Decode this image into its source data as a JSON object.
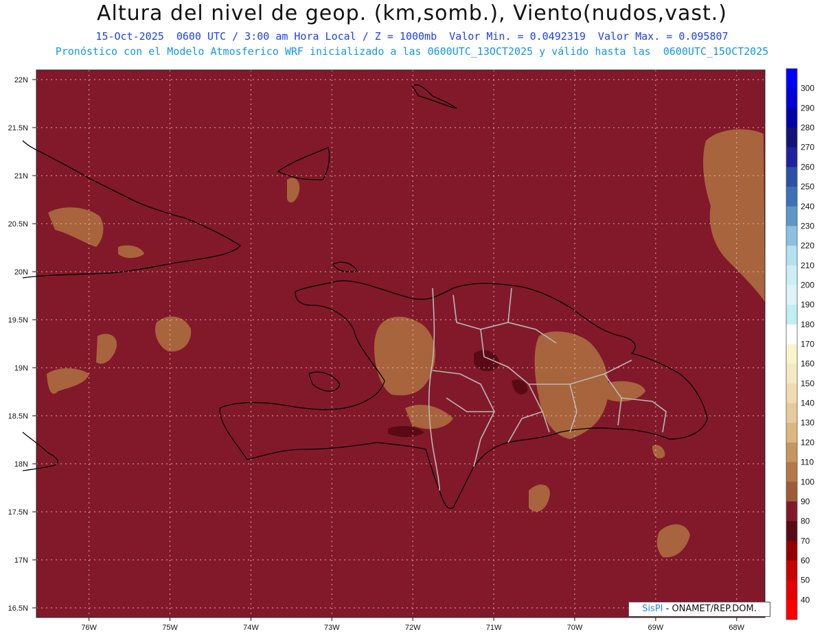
{
  "header": {
    "title": "Altura del nivel de geop. (km,somb.), Viento(nudos,vast.)",
    "subtitle": "15-Oct-2025  0600 UTC / 3:00 am Hora Local / Z = 1000mb  Valor Min. = 0.0492319  Valor Max. = 0.095807",
    "subtitle2": "Pronóstico con el Modelo Atmosferico WRF inicializado a las 0600UTC_13OCT2025 y válido hasta las  0600UTC_15OCT2025"
  },
  "credit": {
    "brand": "SisPI",
    "rest": " - ONAMET/REP.DOM."
  },
  "map_data": {
    "lat_ticks": [
      "22N",
      "21.5N",
      "21N",
      "20.5N",
      "20N",
      "19.5N",
      "19N",
      "18.5N",
      "18N",
      "17.5N",
      "17N",
      "16.5N"
    ],
    "lon_ticks": [
      "76W",
      "75W",
      "74W",
      "73W",
      "72W",
      "71W",
      "70W",
      "69W",
      "68W"
    ],
    "lat_range": [
      16.4,
      22.1
    ],
    "lon_range": [
      -76.65,
      -67.65
    ],
    "background_color": "#82192a",
    "shade_color": "#a8643c",
    "dark_color": "#5a0a14",
    "colorbar": [
      {
        "label": "300",
        "color": "#0000ff"
      },
      {
        "label": "290",
        "color": "#0000d8"
      },
      {
        "label": "280",
        "color": "#0000a8"
      },
      {
        "label": "270",
        "color": "#12127a"
      },
      {
        "label": "260",
        "color": "#2020a0"
      },
      {
        "label": "250",
        "color": "#2d4fa8"
      },
      {
        "label": "240",
        "color": "#3d70b4"
      },
      {
        "label": "230",
        "color": "#5e96c8"
      },
      {
        "label": "220",
        "color": "#8cc0e0"
      },
      {
        "label": "210",
        "color": "#b4e0f0"
      },
      {
        "label": "200",
        "color": "#cceef6"
      },
      {
        "label": "190",
        "color": "#ddf3f8"
      },
      {
        "label": "180",
        "color": "#bfeef5"
      },
      {
        "label": "170",
        "color": "#ffffff"
      },
      {
        "label": "160",
        "color": "#fbf3cc"
      },
      {
        "label": "150",
        "color": "#f5e9c2"
      },
      {
        "label": "140",
        "color": "#f0dcb0"
      },
      {
        "label": "130",
        "color": "#e6cc9c"
      },
      {
        "label": "120",
        "color": "#dcb880"
      },
      {
        "label": "110",
        "color": "#c8965c"
      },
      {
        "label": "100",
        "color": "#b47848"
      },
      {
        "label": "90",
        "color": "#a05a38"
      },
      {
        "label": "80",
        "color": "#82192a"
      },
      {
        "label": "70",
        "color": "#5a0a14"
      },
      {
        "label": "60",
        "color": "#960000"
      },
      {
        "label": "50",
        "color": "#c80000"
      },
      {
        "label": "40",
        "color": "#e60000"
      },
      {
        "label": "",
        "color": "#ff0000"
      }
    ]
  }
}
